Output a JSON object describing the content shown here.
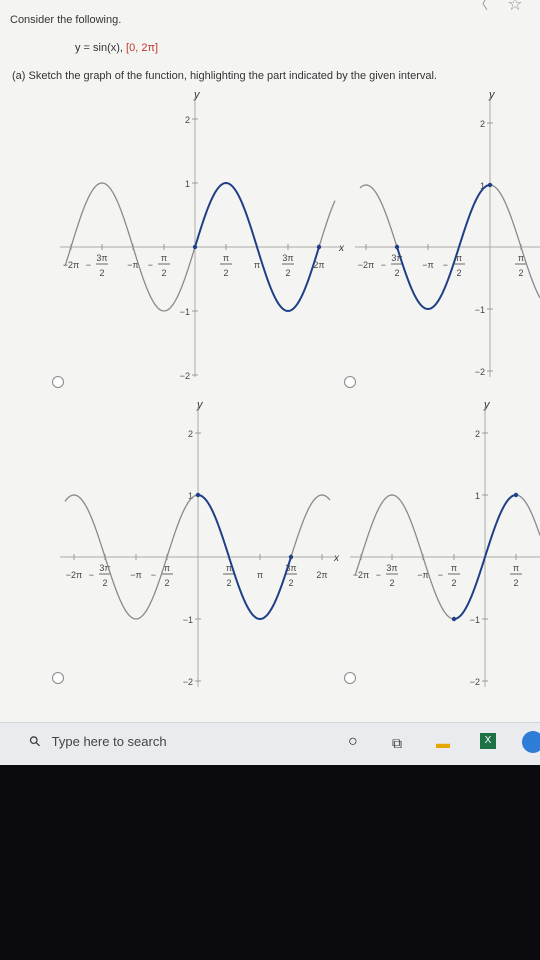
{
  "question": {
    "intro": "Consider the following.",
    "function": "y = sin(x),",
    "interval": "[0, 2π]",
    "part_a": "(a)  Sketch the graph of the function, highlighting the part indicated by the given interval."
  },
  "graph_labels": {
    "y": "y",
    "x": "x",
    "y2": "2",
    "y1": "1",
    "yneg1": "−1",
    "yneg2": "−2",
    "neg2pi": "−2π",
    "neg3pi_num": "3π",
    "neg_pi": "−π",
    "pi_num": "π",
    "den2": "2",
    "pi": "π",
    "threepi_num": "3π",
    "twopi": "2π",
    "minus": "−"
  },
  "options": [
    {
      "id": "a",
      "selected": false
    },
    {
      "id": "b",
      "selected": false
    },
    {
      "id": "c",
      "selected": false
    },
    {
      "id": "d",
      "selected": false
    }
  ],
  "taskbar": {
    "search_placeholder": "Type here to search",
    "icons": [
      "search-icon",
      "cortana-icon",
      "task-view-icon",
      "file-explorer-icon",
      "excel-icon",
      "edge-icon"
    ]
  },
  "colors": {
    "highlight": "#1f3f86",
    "curve": "#8a8a8a",
    "interval_text": "#c0392b"
  }
}
